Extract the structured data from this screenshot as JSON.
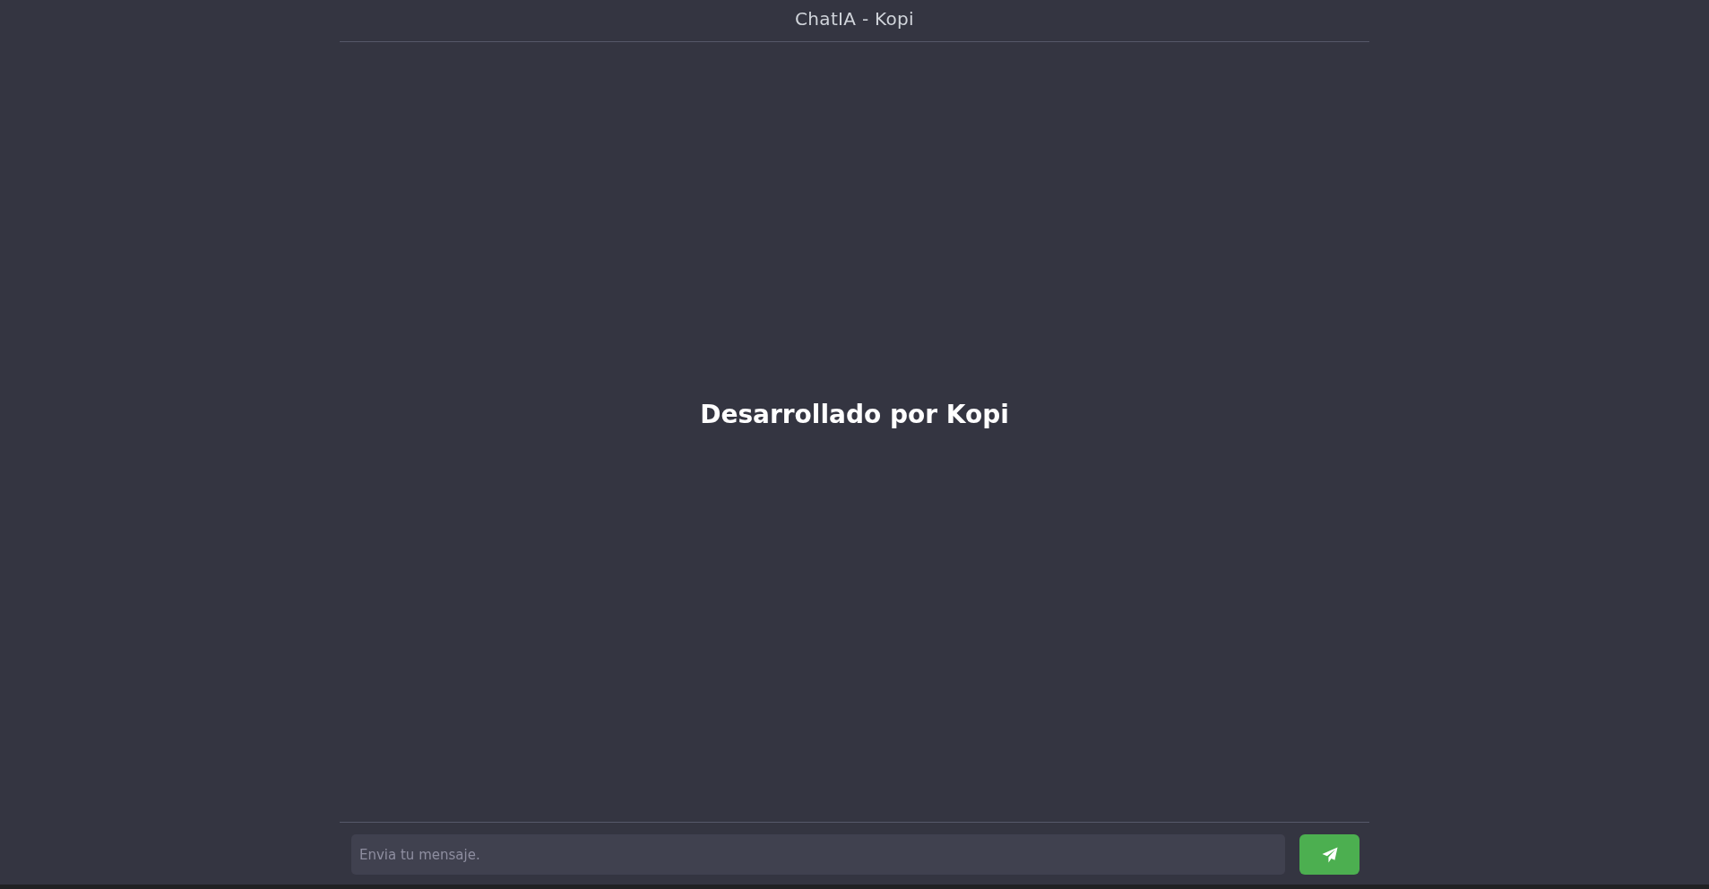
{
  "header": {
    "title": "ChatIA - Kopi"
  },
  "messages_area": {
    "text": "Desarrollado por Kopi"
  },
  "composer": {
    "placeholder": "Envia tu mensaje."
  }
}
